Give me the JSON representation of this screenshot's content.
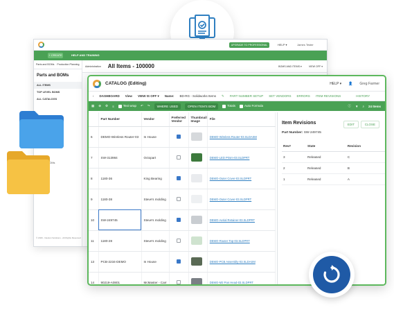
{
  "back_app": {
    "add_button": "+ CREATE",
    "help_training": "HELP AND TRAINING",
    "upgrade": "UPGRADE TO PROFESSIONAL",
    "help": "HELP ▾",
    "user": "James Tester",
    "sidebar_tabs": [
      "Parts and BOMs",
      "Production Planning",
      "Administration"
    ],
    "page_title": "All Items - 100000",
    "sidebar_heading": "Parts and BOMs",
    "sidebar_items": [
      "ALL ITEMS",
      "TOP LEVEL BOMS",
      "ALL CATALOGS"
    ],
    "sidebar_more": [
      "Unlinked BOMs",
      "Catalogs"
    ],
    "bom_items_dropdown": "BOMS AND ITEMS ▾",
    "view_dropdown": "VIEW OFF ▾",
    "create_button": "CREATE",
    "footer": "© 2020 - Newton Solutions - All Rights Reserved"
  },
  "window": {
    "title": "CATALOG (Editing)",
    "help": "HELP ▾",
    "user": "Greg Farmer"
  },
  "nav": {
    "dashboard": "DASHBOARD",
    "view": "View",
    "view_value": "VIEW IS OFF ▾",
    "name_label": "Name:",
    "name_value": "BD-RG - Solidworks Items",
    "tabs": [
      "PART NUMBER SETUP",
      "SET VENDORS",
      "ERRORS",
      "ITEM REVISIONS",
      "HISTORY"
    ]
  },
  "toolbar": {
    "text_wrap": "Text wrap",
    "where_used": "WHERE USED",
    "open_bom": "OPEN ITEM'S BOM",
    "totals": "Totals",
    "auto_formula": "Auto Formula",
    "item_count": "24 Items"
  },
  "grid": {
    "headers": [
      "",
      "Part Number",
      "Vendor",
      "Preferred Vendor",
      "Thumbnail Image",
      "File"
    ],
    "rows": [
      {
        "n": "6",
        "pn": "DEMO-Wireless Router-03",
        "vendor": "In House",
        "pref": true,
        "file": "DEMO-Wireless Router-03.SLDASM"
      },
      {
        "n": "7",
        "pn": "SW-313984",
        "vendor": "Octopart",
        "pref": false,
        "file": "DEMO-LED Prism-03.SLDPRT"
      },
      {
        "n": "8",
        "pn": "1180-36",
        "vendor": "King Bearing",
        "pref": true,
        "file": "DEMO-Outer Cover-03.SLDPRT"
      },
      {
        "n": "9",
        "pn": "1180-38",
        "vendor": "Steve's molding",
        "pref": false,
        "file": "DEMO-Outer Cover-03.SLDPRT"
      },
      {
        "n": "10",
        "pn": "SW-249745",
        "vendor": "Steve's molding",
        "pref": true,
        "file": "DEMO-Aerial Retainer-03.SLDPRT"
      },
      {
        "n": "11",
        "pn": "1180-28",
        "vendor": "Steve's molding",
        "pref": false,
        "file": "DEMO-Router Top-03.SLDPRT"
      },
      {
        "n": "13",
        "pn": "PCB-2234-DEMO",
        "vendor": "In House",
        "pref": true,
        "file": "DEMO-PCB Assembly-03.SLDASM"
      },
      {
        "n": "14",
        "pn": "90219-A0801",
        "vendor": "McMaster - Carr",
        "pref": false,
        "file": "DEMO-M3 Pan Head-03.SLDPRT"
      }
    ]
  },
  "revisions": {
    "title": "Item Revisions",
    "part_label": "Part Number:",
    "part_value": "SW-249745",
    "buttons": [
      "EDIT",
      "CLOSE"
    ],
    "headers": [
      "Rev#",
      "State",
      "Revision"
    ],
    "rows": [
      {
        "rev": "3",
        "state": "Released",
        "revision": "C"
      },
      {
        "rev": "2",
        "state": "Released",
        "revision": "B"
      },
      {
        "rev": "1",
        "state": "Released",
        "revision": "A"
      }
    ]
  },
  "colors": {
    "accent": "#4aa155",
    "brand_blue": "#1f5aa6",
    "link": "#2f7fc1"
  }
}
